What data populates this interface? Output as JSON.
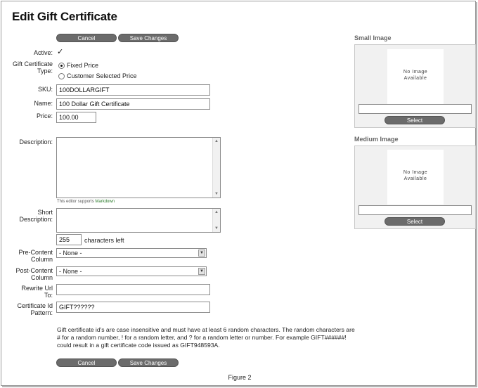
{
  "title": "Edit Gift Certificate",
  "buttons": {
    "cancel": "Cancel",
    "save": "Save Changes"
  },
  "fields": {
    "active_label": "Active:",
    "active_checked": true,
    "type_label_1": "Gift Certificate",
    "type_label_2": "Type:",
    "type_options": [
      "Fixed Price",
      "Customer Selected Price"
    ],
    "type_selected": "Fixed Price",
    "sku_label": "SKU:",
    "sku_value": "100DOLLARGIFT",
    "name_label": "Name:",
    "name_value": "100 Dollar Gift Certificate",
    "price_label": "Price:",
    "price_value": "100.00",
    "description_label": "Description:",
    "editor_note": "This editor supports",
    "editor_link": "Markdown",
    "short_desc_label_1": "Short",
    "short_desc_label_2": "Description:",
    "chars_left_value": "255",
    "chars_left_label": "characters left",
    "pre_content_label_1": "Pre-Content",
    "pre_content_label_2": "Column",
    "pre_content_value": "- None -",
    "post_content_label_1": "Post-Content",
    "post_content_label_2": "Column",
    "post_content_value": "- None -",
    "rewrite_label_1": "Rewrite Url",
    "rewrite_label_2": "To:",
    "rewrite_value": "",
    "cert_pattern_label_1": "Certificate Id",
    "cert_pattern_label_2": "Pattern:",
    "cert_pattern_value": "GIFT??????"
  },
  "help_text": "Gift certificate id's are case insensitive and must have at least 6 random characters. The random characters are # for a random number, ! for a random letter, and ? for a random letter or number. For example GIFT######! could result in a gift certificate code issued as GIFT948593A.",
  "images": {
    "small_title": "Small Image",
    "medium_title": "Medium Image",
    "no_image_1": "No Image",
    "no_image_2": "Available",
    "select_label": "Select"
  },
  "figure_caption": "Figure 2"
}
